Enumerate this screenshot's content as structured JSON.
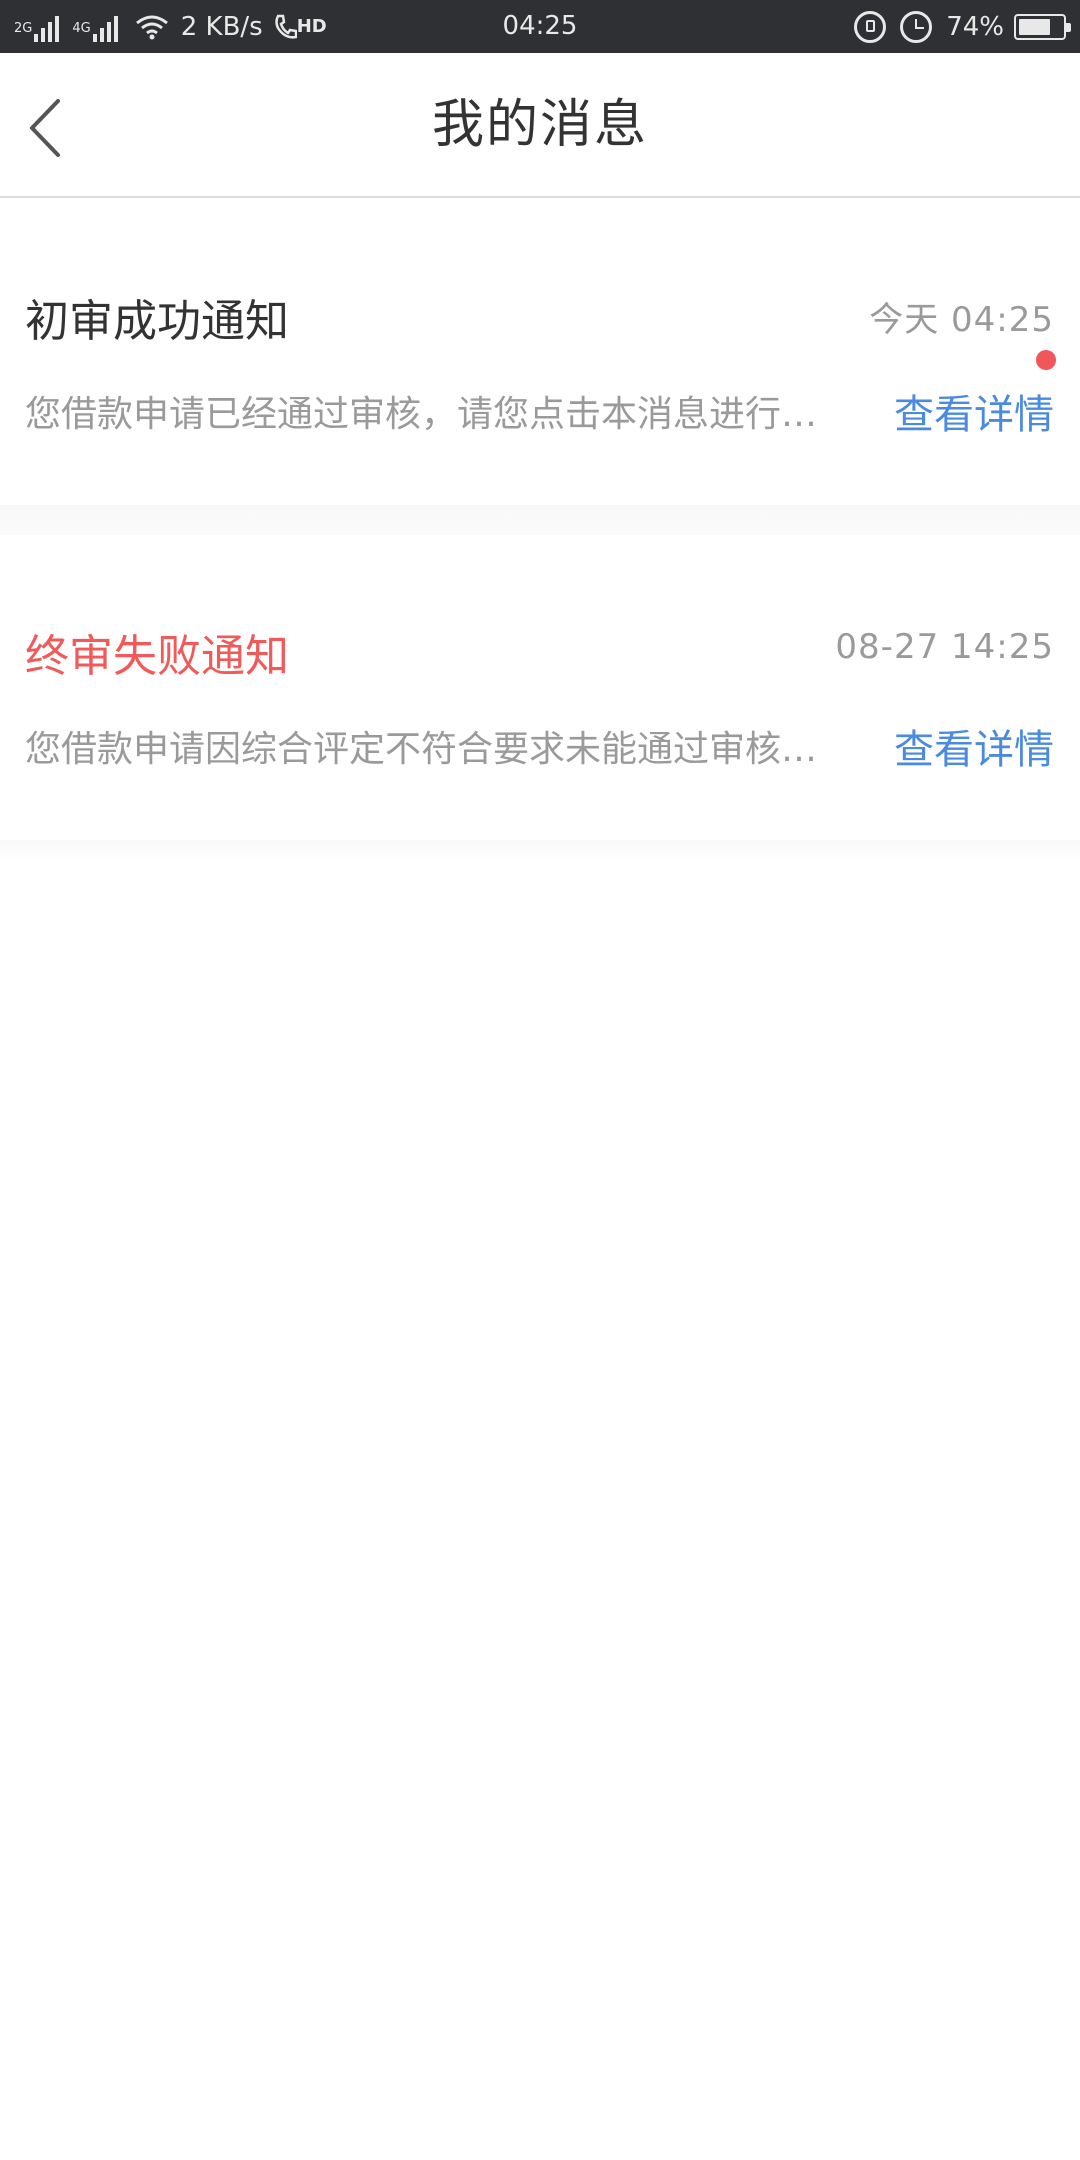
{
  "status_bar": {
    "net1": "2G",
    "net2": "4G",
    "speed": "2 KB/s",
    "hd": "HD",
    "time": "04:25",
    "battery": "74%",
    "battery_level": 0.74
  },
  "header": {
    "title": "我的消息",
    "back_icon": "chevron-left-icon"
  },
  "messages": [
    {
      "title": "初审成功通知",
      "time": "今天 04:25",
      "body": "您借款申请已经通过审核，请您点击本消息进行…",
      "link": "查看详情",
      "unread": true,
      "title_color": "#333333"
    },
    {
      "title": "终审失败通知",
      "time": "08-27 14:25",
      "body": "您借款申请因综合评定不符合要求未能通过审核…",
      "link": "查看详情",
      "unread": false,
      "title_color": "#f25a5a"
    }
  ],
  "colors": {
    "link": "#4a8ae0",
    "unread_dot": "#f0575a",
    "status_bar_bg": "#2f3033"
  }
}
